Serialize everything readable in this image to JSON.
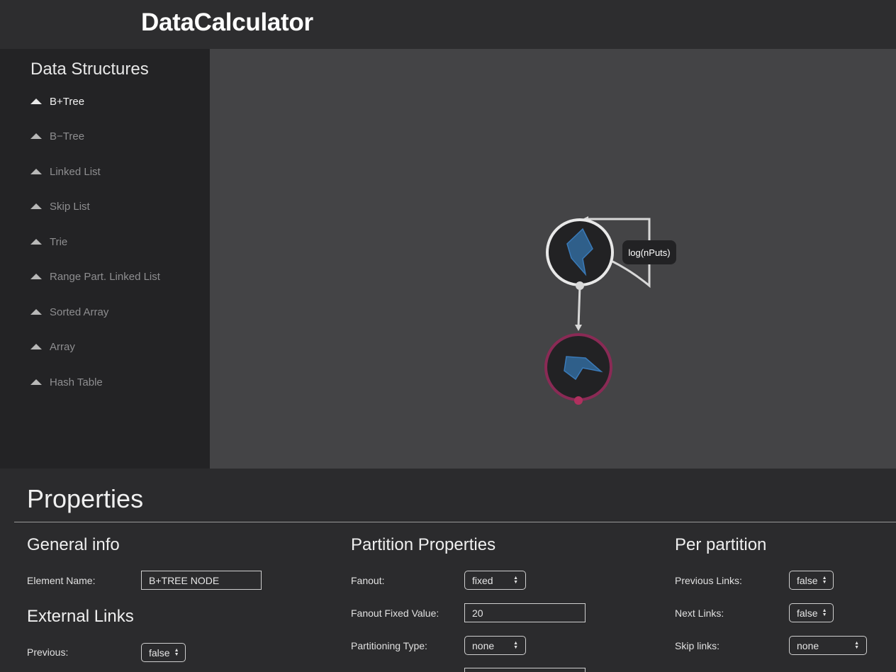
{
  "app": {
    "title": "DataCalculator"
  },
  "sidebar": {
    "title": "Data Structures",
    "items": [
      {
        "label": "B+Tree",
        "active": true
      },
      {
        "label": "B−Tree",
        "active": false
      },
      {
        "label": "Linked List",
        "active": false
      },
      {
        "label": "Skip List",
        "active": false
      },
      {
        "label": "Trie",
        "active": false
      },
      {
        "label": "Range Part. Linked List",
        "active": false
      },
      {
        "label": "Sorted Array",
        "active": false
      },
      {
        "label": "Array",
        "active": false
      },
      {
        "label": "Hash Table",
        "active": false
      }
    ]
  },
  "diagram": {
    "edge_label": "log(nPuts)",
    "colors": {
      "node_ring": "#e8e8e8",
      "leaf_ring": "#8a2a55",
      "leaf_dot": "#b0305e",
      "shape_fill": "#2f5f8a",
      "shape_stroke": "#3a7ab8"
    }
  },
  "properties": {
    "title": "Properties",
    "general": {
      "title": "General info",
      "element_name_label": "Element Name:",
      "element_name_value": "B+TREE NODE"
    },
    "external_links": {
      "title": "External Links",
      "previous_label": "Previous:",
      "previous_value": "false"
    },
    "partition": {
      "title": "Partition Properties",
      "fanout_label": "Fanout:",
      "fanout_value": "fixed",
      "fanout_fixed_label": "Fanout Fixed Value:",
      "fanout_fixed_value": "20",
      "partitioning_type_label": "Partitioning Type:",
      "partitioning_type_value": "none"
    },
    "per_partition": {
      "title": "Per partition",
      "previous_links_label": "Previous Links:",
      "previous_links_value": "false",
      "next_links_label": "Next Links:",
      "next_links_value": "false",
      "skip_links_label": "Skip links:",
      "skip_links_value": "none"
    }
  }
}
